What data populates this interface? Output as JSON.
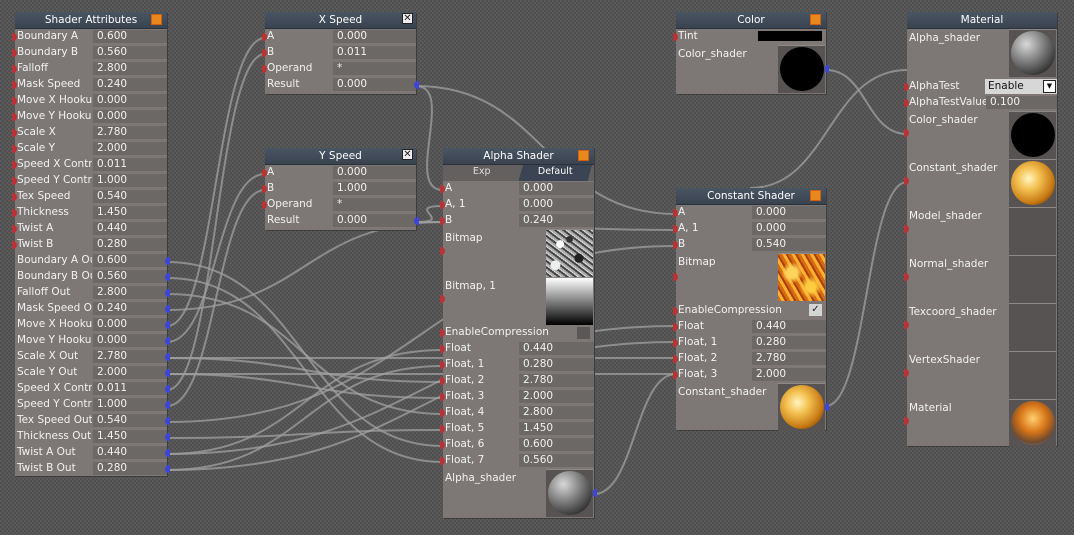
{
  "shader_attributes": {
    "title": "Shader Attributes",
    "inputs": [
      {
        "label": "Boundary  A",
        "value": "0.600"
      },
      {
        "label": "Boundary  B",
        "value": "0.560"
      },
      {
        "label": "Falloff",
        "value": "2.800"
      },
      {
        "label": "Mask Speed",
        "value": "0.240"
      },
      {
        "label": "Move  X Hookup",
        "value": "0.000"
      },
      {
        "label": "Move  Y Hookup",
        "value": "0.000"
      },
      {
        "label": "Scale  X",
        "value": "2.780"
      },
      {
        "label": "Scale  Y",
        "value": "2.000"
      },
      {
        "label": "Speed  X Control",
        "value": "0.011"
      },
      {
        "label": "Speed  Y Control",
        "value": "1.000"
      },
      {
        "label": "Tex Speed",
        "value": "0.540"
      },
      {
        "label": "Thickness",
        "value": "1.450"
      },
      {
        "label": "Twist  A",
        "value": "0.440"
      },
      {
        "label": "Twist  B",
        "value": "0.280"
      }
    ],
    "outputs": [
      {
        "label": "Boundary  A Out",
        "value": "0.600"
      },
      {
        "label": "Boundary  B Out",
        "value": "0.560"
      },
      {
        "label": "Falloff Out",
        "value": "2.800"
      },
      {
        "label": "Mask Speed Out",
        "value": "0.240"
      },
      {
        "label": "Move  X Hookup",
        "value": "0.000"
      },
      {
        "label": "Move  Y Hookup",
        "value": "0.000"
      },
      {
        "label": "Scale  X  Out",
        "value": "2.780"
      },
      {
        "label": "Scale  Y  Out",
        "value": "2.000"
      },
      {
        "label": "Speed  X  Control",
        "value": "0.011"
      },
      {
        "label": "Speed  Y Control",
        "value": "1.000"
      },
      {
        "label": "Tex Speed Out",
        "value": "0.540"
      },
      {
        "label": "Thickness  Out",
        "value": "1.450"
      },
      {
        "label": "Twist  A  Out",
        "value": "0.440"
      },
      {
        "label": "Twist B  Out",
        "value": "0.280"
      }
    ]
  },
  "x_speed": {
    "title": "X Speed",
    "close_glyph": "✕",
    "rows": [
      {
        "label": "A",
        "value": "0.000"
      },
      {
        "label": "B",
        "value": "0.011"
      },
      {
        "label": "Operand",
        "value": "*"
      },
      {
        "label": "Result",
        "value": "0.000"
      }
    ]
  },
  "y_speed": {
    "title": "Y Speed",
    "close_glyph": "✕",
    "rows": [
      {
        "label": "A",
        "value": "0.000"
      },
      {
        "label": "B",
        "value": "1.000"
      },
      {
        "label": "Operand",
        "value": "*"
      },
      {
        "label": "Result",
        "value": "0.000"
      }
    ]
  },
  "alpha_shader": {
    "title": "Alpha Shader",
    "tabs": [
      "Exp",
      "Default"
    ],
    "active_tab": "Default",
    "rows": [
      {
        "label": "A",
        "value": "0.000"
      },
      {
        "label": "A, 1",
        "value": "0.000"
      },
      {
        "label": "B",
        "value": "0.240"
      }
    ],
    "bitmap_label": "Bitmap",
    "bitmap1_label": "Bitmap, 1",
    "enable_label": "EnableCompression",
    "floats": [
      {
        "label": "Float",
        "value": "0.440"
      },
      {
        "label": "Float, 1",
        "value": "0.280"
      },
      {
        "label": "Float, 2",
        "value": "2.780"
      },
      {
        "label": "Float, 3",
        "value": "2.000"
      },
      {
        "label": "Float, 4",
        "value": "2.800"
      },
      {
        "label": "Float, 5",
        "value": "1.450"
      },
      {
        "label": "Float, 6",
        "value": "0.600"
      },
      {
        "label": "Float, 7",
        "value": "0.560"
      }
    ],
    "alpha_label": "Alpha_shader"
  },
  "color": {
    "title": "Color",
    "tint_label": "Tint",
    "tint_color": "#000000",
    "color_shader_label": "Color_shader"
  },
  "constant_shader": {
    "title": "Constant Shader",
    "rows": [
      {
        "label": "A",
        "value": "0.000"
      },
      {
        "label": "A, 1",
        "value": "0.000"
      },
      {
        "label": "B",
        "value": "0.540"
      }
    ],
    "bitmap_label": "Bitmap",
    "enable_label": "EnableCompression",
    "check_glyph": "✓",
    "floats": [
      {
        "label": "Float",
        "value": "0.440"
      },
      {
        "label": "Float, 1",
        "value": "0.280"
      },
      {
        "label": "Float, 2",
        "value": "2.780"
      },
      {
        "label": "Float, 3",
        "value": "2.000"
      }
    ],
    "shader_label": "Constant_shader"
  },
  "material": {
    "title": "Material",
    "alpha_shader_label": "Alpha_shader",
    "alpha_test_label": "AlphaTest",
    "alpha_test_value": "Enable",
    "alpha_test_value_label": "AlphaTestValue",
    "alpha_test_value_num": "0.100",
    "slots": [
      "Color_shader",
      "Constant_shader",
      "Model_shader",
      "Normal_shader",
      "Texcoord_shader",
      "VertexShader",
      "Material"
    ]
  },
  "colors": {
    "wire": "#a0a0a0",
    "input_pin": "#b83434",
    "output_pin": "#3d46d6",
    "title_bar": "#3a4350",
    "node_body": "#7d7876",
    "orange_button": "#e8871c"
  }
}
